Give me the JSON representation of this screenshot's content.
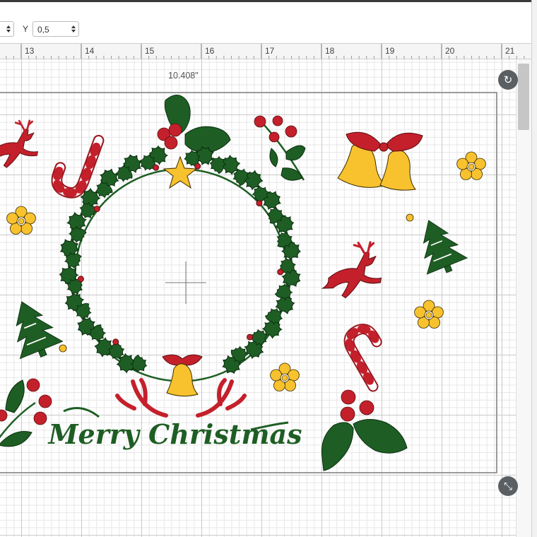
{
  "toolbar": {
    "y_label": "Y",
    "y_value": "0,5"
  },
  "ruler": {
    "ticks": [
      "13",
      "14",
      "15",
      "16",
      "17",
      "18",
      "19",
      "20",
      "21"
    ]
  },
  "canvas": {
    "width_label": "10.408\"",
    "artwork_text": "Merry Christmas"
  },
  "icons": {
    "rotate": "rotate-icon",
    "resize": "resize-icon"
  },
  "colors": {
    "green": "#1e5e24",
    "red": "#c4202b",
    "yellow": "#f7c22e",
    "grid_major": "#c9c9c9",
    "grid_minor": "#e6e6e6",
    "handle": "#5a5f63"
  }
}
